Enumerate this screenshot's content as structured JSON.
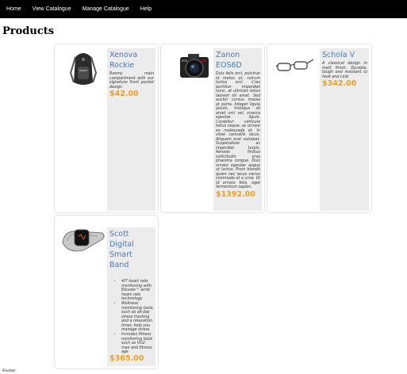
{
  "nav": {
    "items": [
      {
        "label": "Home"
      },
      {
        "label": "View Catalogue"
      },
      {
        "label": "Manage Catalogue"
      },
      {
        "label": "Help"
      }
    ]
  },
  "page": {
    "title": "Products"
  },
  "products": [
    {
      "name": "Xenova Rockie",
      "description": "Roomy main compartment with our signature front pocket design",
      "price": "$42.00",
      "image_icon": "backpack-icon"
    },
    {
      "name": "Zanon EOS6D",
      "description": "Duis felis orci, pulvinar id metus ut, rutrum luctus orci. Cras porttitor imperdiet nunc, at ultricies tellus laoreet sit amet. Sed auctor cursus massa at porta. Integer ligula ipsum, tristique sit amet orci vel, viverra egestas ligula. Curabitur vehicula tellus neque, ac ornare ex malesuada et. In vitae convallis lacus. Aliquam erat volutpat. Suspendisse ac imperdiet turpis. Aenean finibus sollicitudin eros pharetra congue. Duis ornare egestas augue ut luctus. Proin blandit quam nec lacus varius commodo et a urna. Ut id ornare felis, eget fermentum sapien.",
      "price": "$1392.00",
      "image_icon": "camera-icon"
    },
    {
      "name": "Schola V",
      "description": "A classical design in matt finish. Durable, tough and resistant to heat and cold.",
      "price": "$342.00",
      "image_icon": "glasses-icon"
    },
    {
      "name": "Scott Digital Smart Band",
      "features": [
        "4/7 heart rate monitoring with Elevate™ wrist heart rate technology",
        "Wellness monitoring tools, such as all-day stress tracking and a relaxation timer, help you manage stress",
        "Includes fitness monitoring tools such as VO2 max and fitness age"
      ],
      "price": "$365.00",
      "image_icon": "smartband-icon"
    }
  ],
  "footer": {
    "text": "Footer"
  },
  "colors": {
    "navbar": "#000000",
    "product_name": "#4a79b8",
    "price": "#f0a020",
    "info_bg": "#ececec"
  }
}
